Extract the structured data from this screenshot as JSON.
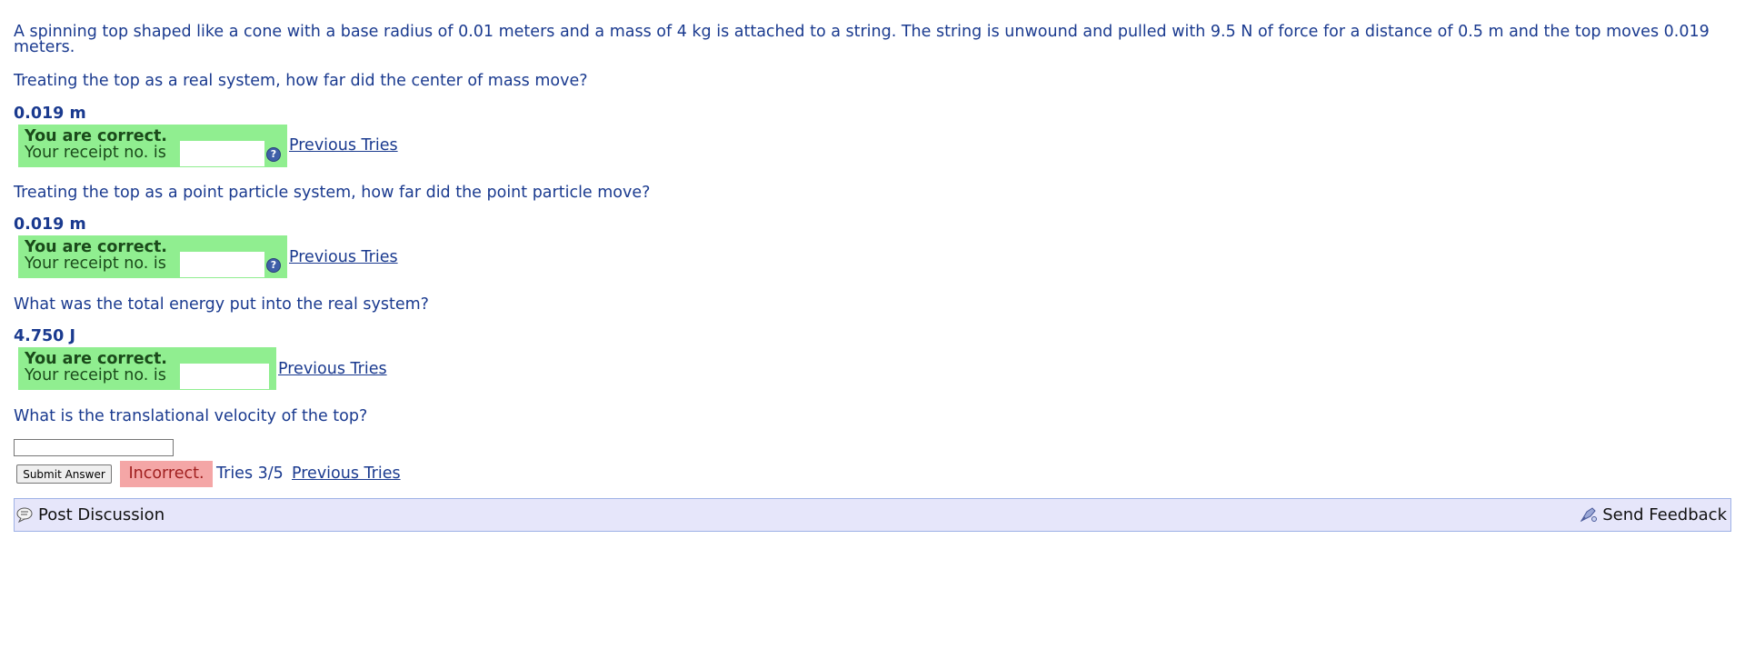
{
  "problem": {
    "intro": "A spinning top shaped like a cone with a base radius of 0.01 meters and a mass of 4 kg is attached to a string. The string is unwound and pulled with 9.5 N of force for a distance of 0.5 m and the top moves 0.019 meters."
  },
  "parts": [
    {
      "question": "Treating the top as a real system, how far did the center of mass move?",
      "answer": "0.019 m",
      "status": "You are correct.",
      "receipt_label": "Your receipt no. is",
      "prev_link": "Previous Tries"
    },
    {
      "question": "Treating the top as a point particle system, how far did the point particle move?",
      "answer": "0.019 m",
      "status": "You are correct.",
      "receipt_label": "Your receipt no. is",
      "prev_link": "Previous Tries"
    },
    {
      "question": "What was the total energy put into the real system?",
      "answer": "4.750 J",
      "status": "You are correct.",
      "receipt_label": "Your receipt no. is",
      "prev_link": "Previous Tries"
    },
    {
      "question": "What is the translational velocity of the top?",
      "input_value": "",
      "submit_label": "Submit Answer",
      "status": "Incorrect.",
      "tries": "Tries 3/5",
      "prev_link": "Previous Tries"
    }
  ],
  "footer": {
    "post_discussion": "Post Discussion",
    "send_feedback": "Send Feedback"
  },
  "colors": {
    "text": "#1a3a8f",
    "correct_bg": "#90ee90",
    "incorrect_bg": "#f4a6a6",
    "footer_bg": "#e6e6fa"
  },
  "icons": [
    "help-icon",
    "discussion-icon",
    "feedback-icon"
  ]
}
